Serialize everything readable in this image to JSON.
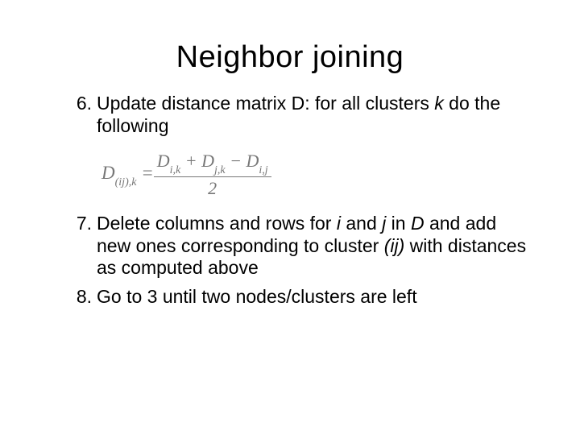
{
  "title": "Neighbor joining",
  "items": {
    "six": {
      "num": "6.",
      "pre": "Update distance matrix D: for all clusters ",
      "k": "k",
      "post": " do the following"
    },
    "seven": {
      "num": "7.",
      "t1": "Delete columns and rows for ",
      "i": "i",
      "t2": " and ",
      "j": "j",
      "t3": " in ",
      "D": "D",
      "t4": " and add new ones corresponding to cluster ",
      "ij": "(ij)",
      "t5": " with distances as computed above"
    },
    "eight": {
      "num": "8.",
      "text": "Go to 3 until two nodes/clusters are left"
    }
  },
  "formula": {
    "lhs_D": "D",
    "lhs_sub": "(ij),k",
    "eq": " = ",
    "num_D1": "D",
    "num_s1": "i,k",
    "plus": " + ",
    "num_D2": "D",
    "num_s2": "j,k",
    "minus": " − ",
    "num_D3": "D",
    "num_s3": "i,j",
    "den": "2"
  }
}
